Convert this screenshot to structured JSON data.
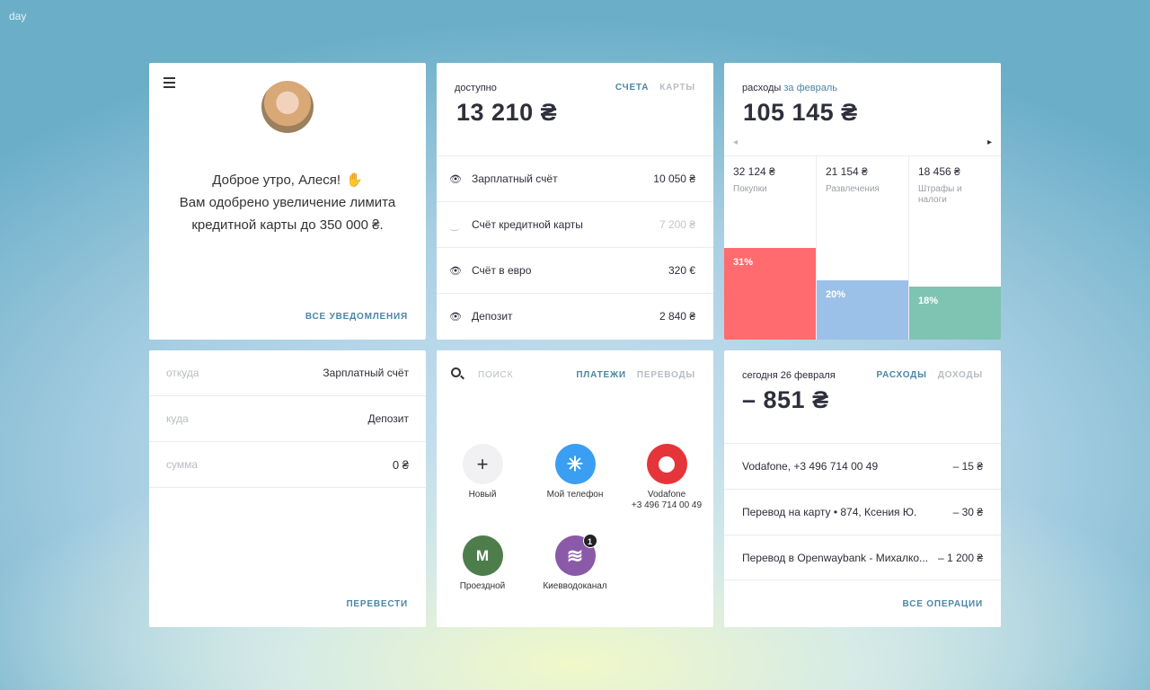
{
  "brand": "day",
  "profile": {
    "greeting": "Доброе утро, Алеся!",
    "message_line1": "Вам одобрено увеличение лимита",
    "message_line2": "кредитной карты до 350 000 ₴.",
    "notifications_link": "все уведомления"
  },
  "accounts": {
    "label": "доступно",
    "balance": "13 210 ₴",
    "tabs": [
      "счета",
      "карты"
    ],
    "items": [
      {
        "name": "Зарплатный счёт",
        "amount": "10 050 ₴",
        "icon": "eye-icon"
      },
      {
        "name": "Счёт кредитной карты",
        "amount": "7 200 ₴",
        "icon": "eye-closed-icon"
      },
      {
        "name": "Счёт в евро",
        "amount": "320 €",
        "icon": "eye-icon"
      },
      {
        "name": "Депозит",
        "amount": "2 840 ₴",
        "icon": "eye-icon"
      }
    ]
  },
  "expenses": {
    "label": "расходы",
    "period": "за февраль",
    "total": "105 145 ₴",
    "categories": [
      {
        "amount": "32 124 ₴",
        "name": "Покупки",
        "percent": "31%",
        "share": 0.31,
        "color": "#ff6b6e"
      },
      {
        "amount": "21 154 ₴",
        "name": "Развлечения",
        "percent": "20%",
        "share": 0.2,
        "color": "#9cc1e8"
      },
      {
        "amount": "18 456 ₴",
        "name": "Штрафы и налоги",
        "percent": "18%",
        "share": 0.18,
        "color": "#7fc4b2"
      }
    ]
  },
  "transfer": {
    "from_label": "откуда",
    "from_value": "Зарплатный счёт",
    "to_label": "куда",
    "to_value": "Депозит",
    "sum_label": "сумма",
    "sum_value": "0 ₴",
    "submit": "перевести"
  },
  "payments": {
    "search_placeholder": "поиск",
    "tabs": [
      "платежи",
      "переводы"
    ],
    "tiles": [
      {
        "label": "Новый",
        "sublabel": "",
        "glyph": "+",
        "color": "#f1f1f3",
        "icon": "plus-icon"
      },
      {
        "label": "Мой телефон",
        "sublabel": "",
        "glyph": "✳",
        "color": "#3a9ef2",
        "icon": "kyivstar-icon"
      },
      {
        "label": "Vodafone",
        "sublabel": "+3 496 714 00 49",
        "glyph": "●",
        "color": "#e5353b",
        "icon": "vodafone-icon"
      },
      {
        "label": "Проездной",
        "sublabel": "",
        "glyph": "М",
        "color": "#4e7d4c",
        "icon": "metro-icon"
      },
      {
        "label": "Киевводоканал",
        "sublabel": "",
        "glyph": "≋",
        "color": "#8a5aa8",
        "icon": "water-icon",
        "badge": "1"
      }
    ]
  },
  "operations": {
    "label": "сегодня 26 февраля",
    "tabs": [
      "расходы",
      "доходы"
    ],
    "total": "– 851 ₴",
    "items": [
      {
        "name": "Vodafone, +3 496 714 00 49",
        "amount": "– 15 ₴"
      },
      {
        "name": "Перевод на карту  • 874, Ксения Ю.",
        "amount": "– 30 ₴"
      },
      {
        "name": "Перевод в Openwaybank - Михалко...",
        "amount": "– 1 200 ₴"
      }
    ],
    "all_link": "все операции"
  }
}
